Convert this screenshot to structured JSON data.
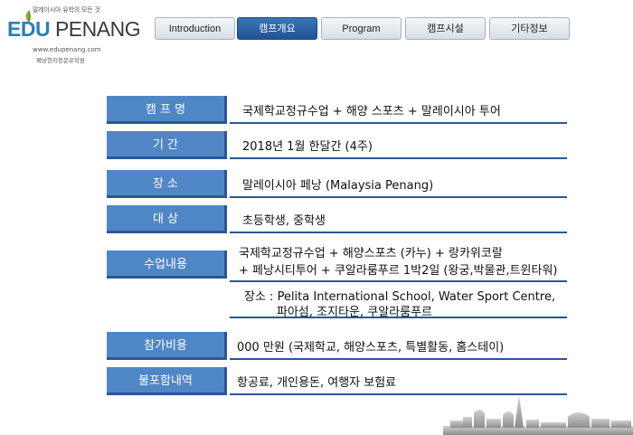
{
  "logo": {
    "tagline": "말레이시아 유학의 모든 것",
    "brand_edu": "EDU",
    "brand_penang": "PENANG",
    "url": "www.edupenang.com",
    "subtitle": "페낭현지전문유학원"
  },
  "nav": {
    "tabs": [
      {
        "label": "Introduction"
      },
      {
        "label": "캠프개요"
      },
      {
        "label": "Program"
      },
      {
        "label": "캠프시설"
      },
      {
        "label": "기타정보"
      }
    ],
    "active": "캠프개요"
  },
  "rows": [
    {
      "label": "캠 프 명",
      "value": "국제학교정규수업  + 해양 스포츠 + 말레이시아 투어"
    },
    {
      "label": "기      간",
      "value": "2018년 1월 한달간 (4주)"
    },
    {
      "label": "장      소",
      "value": "말레이시아 페낭 (Malaysia Penang)"
    },
    {
      "label": "대      상",
      "value": "초등학생, 중학생"
    },
    {
      "label": "수업내용",
      "value_line1": "국제학교정규수업  + 해양스포츠 (카누) + 랑카위코랄",
      "value_line2": "+ 페낭시티투어 + 쿠알라룸푸르 1박2일 (왕궁,박물관,트윈타워)"
    },
    {
      "label": "참가비용",
      "value": "000 만원  (국제학교, 해양스포츠, 특별활동, 홈스테이)"
    },
    {
      "label": "불포함내역",
      "value": "항공료, 개인용돈, 여행자 보험료"
    }
  ],
  "note": {
    "line1": "장소 : Pelita International School, Water Sport Centre,",
    "line2": "파아섬, 조지타운, 쿠알라룸푸르"
  },
  "colors": {
    "label_bg": "#4f86c6",
    "label_shadow": "#2b5794",
    "nav_active": "#2b5f9e",
    "brand_blue": "#2f7dbb"
  }
}
